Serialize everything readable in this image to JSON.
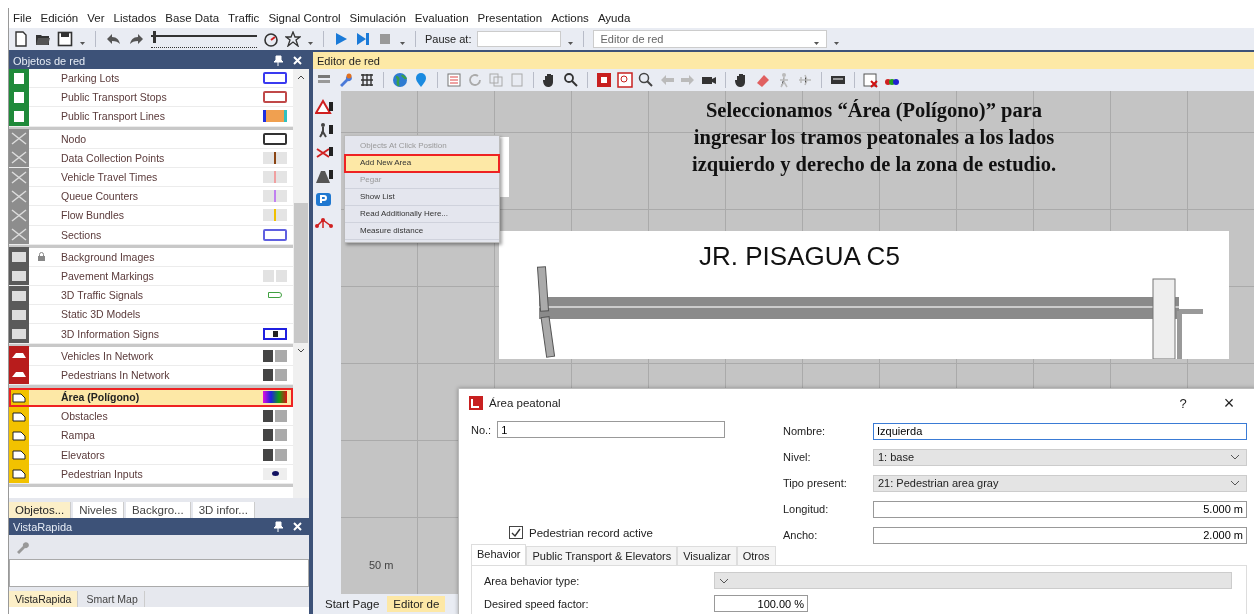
{
  "menu": [
    "File",
    "Edición",
    "Ver",
    "Listados",
    "Base Data",
    "Traffic",
    "Signal Control",
    "Simulación",
    "Evaluation",
    "Presentation",
    "Actions",
    "Ayuda"
  ],
  "toolbar": {
    "speed_slider": {
      "level": 0.02
    },
    "pause_label": "Pause at:",
    "view_select": "Editor de red"
  },
  "objects_panel": {
    "title": "Objetos de red",
    "groups": [
      {
        "rows": [
          {
            "label": "Parking Lots",
            "selected": false,
            "locked": false,
            "kind": "outline",
            "color": "#3a3af0"
          },
          {
            "label": "Public Transport Stops",
            "selected": false,
            "locked": false,
            "kind": "outline",
            "color": "#c04848"
          },
          {
            "label": "Public Transport Lines",
            "selected": false,
            "locked": false,
            "kind": "bar",
            "color": "#f0a050"
          }
        ]
      },
      {
        "rows": [
          {
            "label": "Nodo",
            "selected": false,
            "locked": false,
            "kind": "outline",
            "color": "#333333"
          },
          {
            "label": "Data Collection Points",
            "selected": false,
            "locked": false,
            "kind": "tick",
            "color": "#8b4513"
          },
          {
            "label": "Vehicle Travel Times",
            "selected": false,
            "locked": false,
            "kind": "tick",
            "color": "#f0a0a0"
          },
          {
            "label": "Queue Counters",
            "selected": false,
            "locked": false,
            "kind": "tick",
            "color": "#c080f0"
          },
          {
            "label": "Flow Bundles",
            "selected": false,
            "locked": false,
            "kind": "tick",
            "color": "#f0c000"
          },
          {
            "label": "Sections",
            "selected": false,
            "locked": false,
            "kind": "outline",
            "color": "#6060e0"
          }
        ]
      },
      {
        "rows": [
          {
            "label": "Background Images",
            "selected": false,
            "locked": true,
            "kind": "none"
          },
          {
            "label": "Pavement Markings",
            "selected": false,
            "locked": false,
            "kind": "split"
          },
          {
            "label": "3D Traffic Signals",
            "selected": false,
            "locked": false,
            "kind": "link",
            "color": "#40a040"
          },
          {
            "label": "Static 3D Models",
            "selected": false,
            "locked": false,
            "kind": "none"
          },
          {
            "label": "3D Information Signs",
            "selected": false,
            "locked": false,
            "kind": "info",
            "color": "#2020e0"
          }
        ]
      },
      {
        "rows": [
          {
            "label": "Vehicles In Network",
            "selected": false,
            "locked": false,
            "kind": "dark"
          },
          {
            "label": "Pedestrians In Network",
            "selected": false,
            "locked": false,
            "kind": "dark"
          }
        ]
      },
      {
        "rows": [
          {
            "label": "Área (Polígono)",
            "selected": true,
            "locked": false,
            "kind": "rainbow"
          },
          {
            "label": "Obstacles",
            "selected": false,
            "locked": false,
            "kind": "dark"
          },
          {
            "label": "Rampa",
            "selected": false,
            "locked": false,
            "kind": "dark"
          },
          {
            "label": "Elevators",
            "selected": false,
            "locked": false,
            "kind": "dark"
          },
          {
            "label": "Pedestrian Inputs",
            "selected": false,
            "locked": false,
            "kind": "dot",
            "color": "#101060"
          }
        ]
      }
    ],
    "tabs": [
      {
        "label": "Objetos...",
        "selected": true
      },
      {
        "label": "Niveles",
        "selected": false
      },
      {
        "label": "Backgro...",
        "selected": false
      },
      {
        "label": "3D infor...",
        "selected": false
      }
    ]
  },
  "quick_view": {
    "title": "VistaRapida",
    "tabs": [
      {
        "label": "VistaRapida",
        "selected": true
      },
      {
        "label": "Smart Map",
        "selected": false
      }
    ]
  },
  "editor": {
    "title": "Editor de red",
    "annotation": "Seleccionamos “Área (Polígono)” para\ningresar los tramos peatonales a los lados\nizquierdo y derecho de la zona de estudio.",
    "picture_title": "JR. PISAGUA C5",
    "scale": "50 m",
    "context_menu": [
      {
        "label": "Objects At Click Position",
        "disabled": true,
        "selected": false
      },
      {
        "label": "Add New Area",
        "disabled": false,
        "selected": true
      },
      {
        "label": "Pegar",
        "disabled": true,
        "selected": false
      },
      {
        "label": "Show List",
        "disabled": false,
        "selected": false
      },
      {
        "label": "Read Additionally Here...",
        "disabled": false,
        "selected": false
      },
      {
        "label": "Measure distance",
        "disabled": false,
        "selected": false
      }
    ],
    "bottom_tabs": [
      {
        "label": "Start Page",
        "selected": false
      },
      {
        "label": "Editor de",
        "selected": true
      }
    ]
  },
  "dialog": {
    "title": "Área peatonal",
    "help": "?",
    "close": "×",
    "no_label": "No.:",
    "no_value": "1",
    "fields": [
      {
        "label": "Nombre:",
        "value": "Izquierda",
        "kind": "text"
      },
      {
        "label": "Nivel:",
        "value": "1: base",
        "kind": "select"
      },
      {
        "label": "Tipo present:",
        "value": "21: Pedestrian area gray",
        "kind": "select"
      },
      {
        "label": "Longitud:",
        "value": "5.000 m",
        "kind": "number"
      },
      {
        "label": "Ancho:",
        "value": "2.000 m",
        "kind": "number"
      }
    ],
    "checkbox": {
      "label": "Pedestrian record active",
      "checked": true
    },
    "tabs": [
      {
        "label": "Behavior",
        "selected": true
      },
      {
        "label": "Public Transport & Elevators",
        "selected": false
      },
      {
        "label": "Visualizar",
        "selected": false
      },
      {
        "label": "Otros",
        "selected": false
      }
    ],
    "behavior": [
      {
        "label": "Area behavior type:",
        "kind": "select"
      },
      {
        "label": "Desired speed factor:",
        "kind": "number",
        "value": "100.00 %"
      }
    ]
  }
}
